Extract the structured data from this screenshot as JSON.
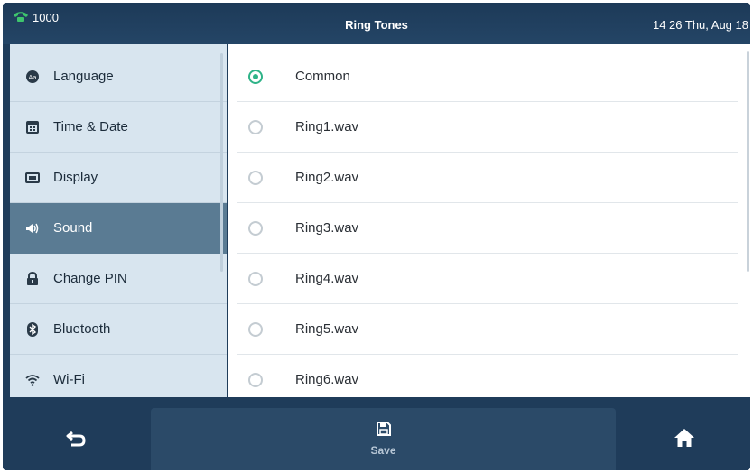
{
  "status_bar": {
    "line_label": "1000",
    "title": "Ring Tones",
    "datetime": "14 26 Thu, Aug 18"
  },
  "sidebar": {
    "items": [
      {
        "label": "Language",
        "icon": "language-icon"
      },
      {
        "label": "Time & Date",
        "icon": "calendar-icon"
      },
      {
        "label": "Display",
        "icon": "display-icon"
      },
      {
        "label": "Sound",
        "icon": "speaker-icon",
        "active": true
      },
      {
        "label": "Change PIN",
        "icon": "lock-icon"
      },
      {
        "label": "Bluetooth",
        "icon": "bluetooth-icon"
      },
      {
        "label": "Wi-Fi",
        "icon": "wifi-icon"
      }
    ]
  },
  "ring_tones": {
    "items": [
      {
        "label": "Common",
        "selected": true
      },
      {
        "label": "Ring1.wav",
        "selected": false
      },
      {
        "label": "Ring2.wav",
        "selected": false
      },
      {
        "label": "Ring3.wav",
        "selected": false
      },
      {
        "label": "Ring4.wav",
        "selected": false
      },
      {
        "label": "Ring5.wav",
        "selected": false
      },
      {
        "label": "Ring6.wav",
        "selected": false
      }
    ]
  },
  "bottom_bar": {
    "save_label": "Save",
    "back_icon": "back-arrow-icon",
    "save_icon": "floppy-disk-icon",
    "home_icon": "home-icon"
  },
  "colors": {
    "frame": "#1f3c5a",
    "sidebar_bg": "#d8e5ef",
    "sidebar_active": "#5a7b93",
    "radio_selected": "#2fb388"
  }
}
